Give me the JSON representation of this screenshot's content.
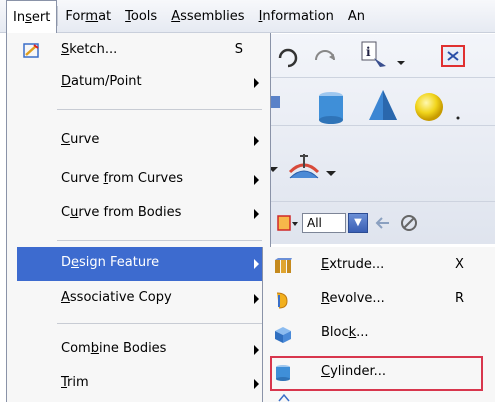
{
  "menubar": {
    "items": [
      {
        "label": "Insert",
        "u": "s"
      },
      {
        "label": "Format",
        "u": "m"
      },
      {
        "label": "Tools",
        "u": "T"
      },
      {
        "label": "Assemblies",
        "u": "A"
      },
      {
        "label": "Information",
        "u": "I"
      },
      {
        "label": "An"
      }
    ]
  },
  "toolbar": {
    "filter_value": "All"
  },
  "insert_menu": {
    "items": [
      {
        "pre": "",
        "u": "S",
        "post": "ketch...",
        "accel": "S",
        "icon": "sketch-icon"
      },
      {
        "pre": "",
        "u": "D",
        "post": "atum/Point",
        "submenu": true
      },
      {
        "pre": "",
        "u": "C",
        "post": "urve",
        "submenu": true
      },
      {
        "pre": "Curve ",
        "u": "f",
        "post": "rom Curves",
        "submenu": true
      },
      {
        "pre": "C",
        "u": "u",
        "post": "rve from Bodies",
        "submenu": true
      },
      {
        "pre": "D",
        "u": "e",
        "post": "sign Feature",
        "submenu": true,
        "highlighted": true
      },
      {
        "pre": "",
        "u": "A",
        "post": "ssociative Copy",
        "submenu": true
      },
      {
        "pre": "Com",
        "u": "b",
        "post": "ine Bodies",
        "submenu": true
      },
      {
        "pre": "",
        "u": "T",
        "post": "rim",
        "submenu": true
      }
    ]
  },
  "design_feature_submenu": {
    "items": [
      {
        "pre": "",
        "u": "E",
        "post": "xtrude...",
        "accel": "X",
        "icon": "extrude-icon"
      },
      {
        "pre": "",
        "u": "R",
        "post": "evolve...",
        "accel": "R",
        "icon": "revolve-icon"
      },
      {
        "pre": "Bloc",
        "u": "k",
        "post": "...",
        "accel": "",
        "icon": "block-icon"
      },
      {
        "pre": "",
        "u": "C",
        "post": "ylinder...",
        "accel": "",
        "icon": "cylinder-icon",
        "callout": true
      }
    ]
  },
  "colors": {
    "highlight": "#3d6bcf",
    "callout": "#d8364d"
  }
}
